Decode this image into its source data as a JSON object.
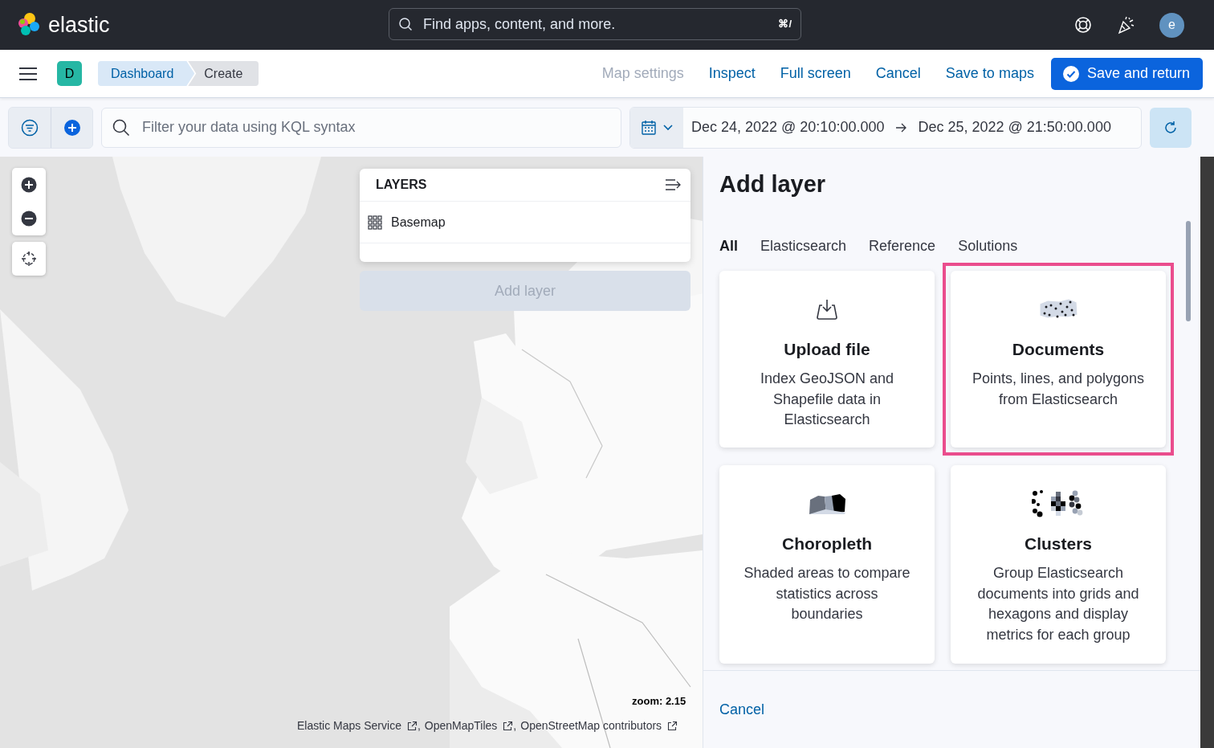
{
  "header": {
    "logo_text": "elastic",
    "search": {
      "placeholder": "Find apps, content, and more.",
      "shortcut": "⌘/"
    },
    "avatar": "e"
  },
  "nav": {
    "space_badge": "D",
    "breadcrumbs": [
      {
        "label": "Dashboard",
        "selected": false
      },
      {
        "label": "Create",
        "selected": true
      }
    ],
    "actions": [
      {
        "label": "Map settings",
        "disabled": true
      },
      {
        "label": "Inspect",
        "disabled": false
      },
      {
        "label": "Full screen",
        "disabled": false
      },
      {
        "label": "Cancel",
        "disabled": false
      },
      {
        "label": "Save to maps",
        "disabled": false
      }
    ],
    "primary_action": "Save and return"
  },
  "query_bar": {
    "placeholder": "Filter your data using KQL syntax",
    "start": "Dec 24, 2022 @ 20:10:00.000",
    "end": "Dec 25, 2022 @ 21:50:00.000"
  },
  "map": {
    "layers_panel": {
      "title": "LAYERS",
      "layers": [
        "Basemap"
      ]
    },
    "add_layer_button": {
      "label": "Add layer",
      "disabled": true
    },
    "zoom": "zoom: 2.15",
    "attributions": [
      {
        "label": "Elastic Maps Service",
        "separator": ","
      },
      {
        "label": "OpenMapTiles",
        "separator": ","
      },
      {
        "label": "OpenStreetMap contributors"
      }
    ]
  },
  "panel": {
    "title": "Add layer",
    "tabs": [
      {
        "label": "All",
        "selected": true
      },
      {
        "label": "Elasticsearch",
        "selected": false
      },
      {
        "label": "Reference",
        "selected": false
      },
      {
        "label": "Solutions",
        "selected": false
      }
    ],
    "cards": [
      {
        "kind": "upload",
        "title": "Upload file",
        "description": "Index GeoJSON and Shapefile data in Elasticsearch",
        "highlighted": false
      },
      {
        "kind": "documents",
        "title": "Documents",
        "description": "Points, lines, and polygons from Elasticsearch",
        "highlighted": true
      },
      {
        "kind": "choropleth",
        "title": "Choropleth",
        "description": "Shaded areas to compare statistics across boundaries",
        "highlighted": false
      },
      {
        "kind": "clusters",
        "title": "Clusters",
        "description": "Group Elasticsearch documents into grids and hexagons and display metrics for each group",
        "highlighted": false
      }
    ],
    "cancel": "Cancel"
  }
}
